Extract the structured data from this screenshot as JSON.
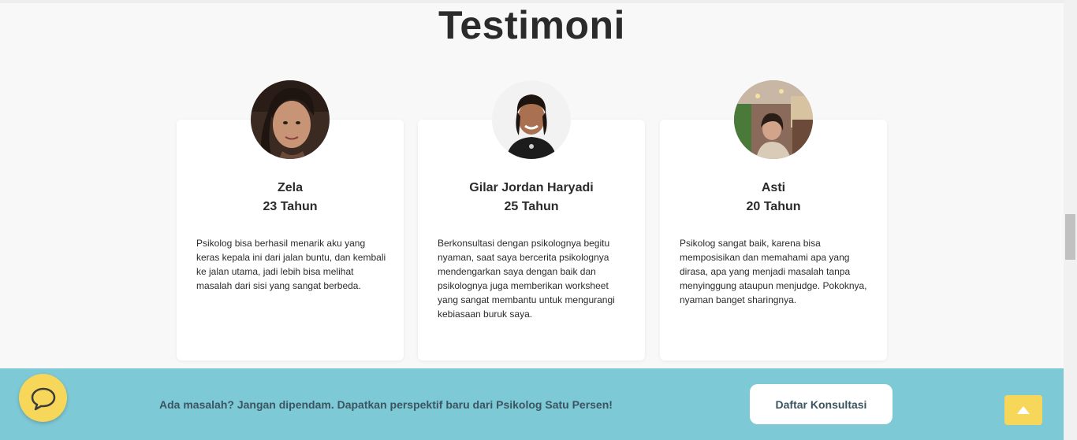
{
  "section": {
    "title": "Testimoni"
  },
  "testimonials": [
    {
      "name": "Zela",
      "age": "23 Tahun",
      "text": "Psikolog bisa berhasil menarik aku yang keras kepala ini dari jalan buntu, dan kembali ke jalan utama, jadi lebih bisa melihat masalah dari sisi yang sangat berbeda."
    },
    {
      "name": "Gilar Jordan Haryadi",
      "age": "25 Tahun",
      "text": "Berkonsultasi dengan psikolognya begitu nyaman, saat saya bercerita psikolognya mendengarkan saya dengan baik dan psikolognya juga memberikan worksheet yang sangat membantu untuk mengurangi kebiasaan buruk saya."
    },
    {
      "name": "Asti",
      "age": "20 Tahun",
      "text": "Psikolog sangat baik, karena bisa memposisikan dan memahami apa yang dirasa, apa yang menjadi masalah tanpa menyinggung ataupun menjudge. Pokoknya, nyaman banget sharingnya."
    }
  ],
  "cta": {
    "message": "Ada masalah? Jangan dipendam. Dapatkan perspektif baru dari Psikolog Satu Persen!",
    "button_label": "Daftar Konsultasi"
  },
  "icons": {
    "chat": "chat-bubble-icon",
    "back_to_top": "chevron-up-icon"
  },
  "colors": {
    "cta_background": "#7ec9d6",
    "accent_yellow": "#f6d75a",
    "card_background": "#ffffff",
    "page_background": "#f8f8f8"
  }
}
